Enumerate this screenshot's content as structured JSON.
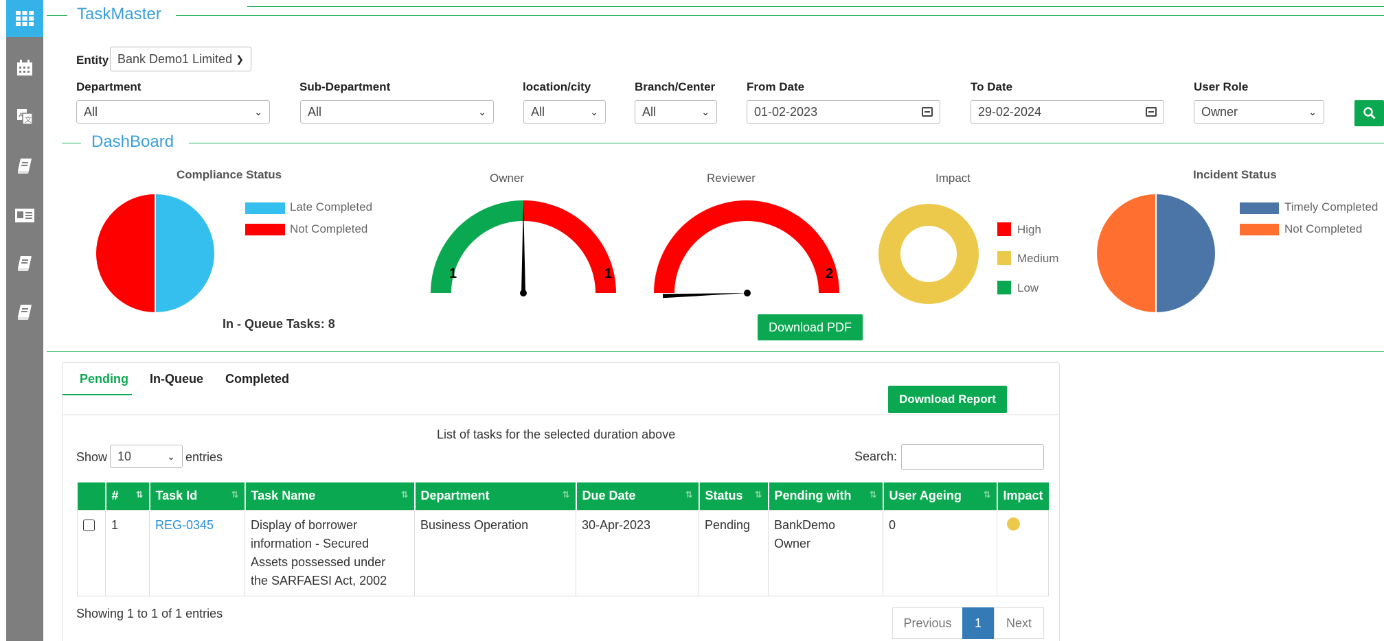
{
  "app": {
    "title": "TaskMaster",
    "dashboard_title": "DashBoard"
  },
  "sidebar": {
    "items": [
      "apps-icon",
      "calendar-icon",
      "translate-icon",
      "book-icon",
      "id-card-icon",
      "book-icon",
      "book-icon"
    ]
  },
  "filters": {
    "entity_label": "Entity",
    "entity_value": "Bank Demo1 Limited",
    "department_label": "Department",
    "department_value": "All",
    "subdepartment_label": "Sub-Department",
    "subdepartment_value": "All",
    "location_label": "location/city",
    "location_value": "All",
    "branch_label": "Branch/Center",
    "branch_value": "All",
    "from_label": "From Date",
    "from_value": "01-02-2023",
    "to_label": "To Date",
    "to_value": "29-02-2024",
    "role_label": "User Role",
    "role_value": "Owner"
  },
  "charts": {
    "compliance": {
      "title": "Compliance Status",
      "legend": [
        "Late Completed",
        "Not Completed"
      ],
      "colors": [
        "#35bfee",
        "#ff0000"
      ]
    },
    "owner": {
      "title": "Owner",
      "left_value": "1",
      "right_value": "1"
    },
    "reviewer": {
      "title": "Reviewer",
      "right_value": "2"
    },
    "impact": {
      "title": "Impact",
      "legend": [
        "High",
        "Medium",
        "Low"
      ],
      "colors": [
        "#ff0000",
        "#ecc94b",
        "#0aa850"
      ]
    },
    "incident": {
      "title": "Incident Status",
      "legend": [
        "Timely Completed",
        "Not Completed"
      ],
      "colors": [
        "#4a75a6",
        "#ff7030"
      ]
    }
  },
  "queue_text": "In - Queue Tasks: 8",
  "download_pdf": "Download PDF",
  "tabs": [
    "Pending",
    "In-Queue",
    "Completed"
  ],
  "download_report": "Download Report",
  "list_caption": "List of tasks for the selected duration above",
  "show_label": "Show",
  "entries_value": "10",
  "entries_label": "entries",
  "search_label": "Search:",
  "table": {
    "headers": [
      "#",
      "Task Id",
      "Task Name",
      "Department",
      "Due Date",
      "Status",
      "Pending with",
      "User Ageing",
      "Impact"
    ],
    "rows": [
      {
        "num": "1",
        "task_id": "REG-0345",
        "task_name_lines": [
          "Display of borrower",
          "information - Secured",
          "Assets possessed under",
          "the SARFAESI Act, 2002"
        ],
        "department": "Business Operation",
        "due_date": "30-Apr-2023",
        "status": "Pending",
        "pending_with_lines": [
          "BankDemo",
          "Owner"
        ],
        "user_ageing": "0",
        "impact_color": "#ecc94b"
      }
    ]
  },
  "footer": {
    "showing": "Showing 1 to 1 of 1 entries",
    "previous": "Previous",
    "page": "1",
    "next": "Next"
  }
}
